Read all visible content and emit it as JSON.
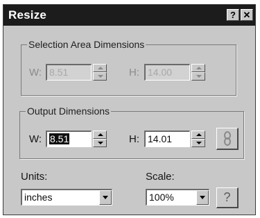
{
  "window": {
    "title": "Resize",
    "help_glyph": "?",
    "close_glyph": "✕"
  },
  "selection_area": {
    "legend": "Selection Area Dimensions",
    "width_label": "W:",
    "width_value": "8.51",
    "height_label": "H:",
    "height_value": "14.00"
  },
  "output": {
    "legend": "Output Dimensions",
    "width_label": "W:",
    "width_value": "8.51",
    "height_label": "H:",
    "height_value": "14.01",
    "link_icon": "chain-link-icon"
  },
  "units": {
    "label": "Units:",
    "selected": "inches"
  },
  "scale": {
    "label": "Scale:",
    "selected": "100%"
  },
  "help_button": {
    "glyph": "?"
  }
}
